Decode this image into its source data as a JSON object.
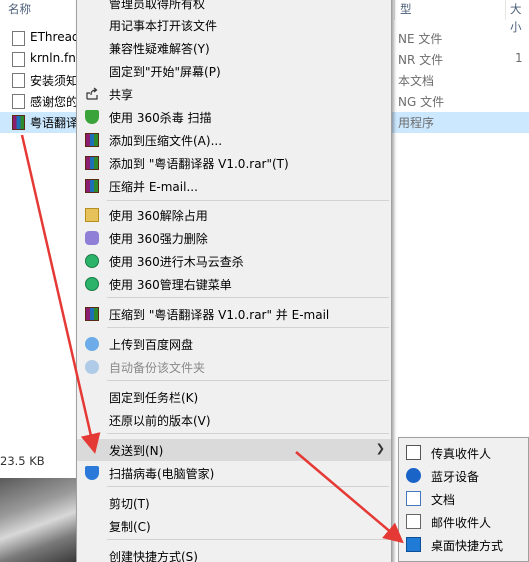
{
  "explorer": {
    "columns": {
      "name": "名称",
      "type": "型",
      "size": "大小"
    },
    "files": [
      {
        "name": "EThread",
        "type": "NE 文件",
        "size": ""
      },
      {
        "name": "krnln.fn",
        "type": "NR 文件",
        "size": "1"
      },
      {
        "name": "安装须知",
        "type": "本文档",
        "size": ""
      },
      {
        "name": "感谢您的",
        "type": "NG 文件",
        "size": ""
      },
      {
        "name": "粤语翻译",
        "type": "用程序",
        "size": ""
      }
    ],
    "status_size": "23.5 KB"
  },
  "context_menu": {
    "items": [
      {
        "label": "管理员取得所有权",
        "icon": "none"
      },
      {
        "label": "用记事本打开该文件",
        "icon": "none"
      },
      {
        "label": "兼容性疑难解答(Y)",
        "icon": "none"
      },
      {
        "label": "固定到\"开始\"屏幕(P)",
        "icon": "none"
      },
      {
        "label": "共享",
        "icon": "share-icon"
      },
      {
        "label": "使用 360杀毒 扫描",
        "icon": "360-antivirus-icon"
      },
      {
        "label": "添加到压缩文件(A)...",
        "icon": "winrar-icon"
      },
      {
        "label": "添加到 \"粤语翻译器 V1.0.rar\"(T)",
        "icon": "winrar-icon"
      },
      {
        "label": "压缩并 E-mail...",
        "icon": "winrar-icon"
      },
      {
        "label": "使用 360解除占用",
        "icon": "360-unlock-icon"
      },
      {
        "label": "使用 360强力删除",
        "icon": "360-delete-icon"
      },
      {
        "label": "使用 360进行木马云查杀",
        "icon": "360-trojan-icon"
      },
      {
        "label": "使用 360管理右键菜单",
        "icon": "360-menu-icon"
      },
      {
        "label": "压缩到 \"粤语翻译器 V1.0.rar\" 并 E-mail",
        "icon": "winrar-icon"
      },
      {
        "label": "上传到百度网盘",
        "icon": "baidu-cloud-icon"
      },
      {
        "label": "自动备份该文件夹",
        "icon": "baidu-cloud-icon"
      },
      {
        "label": "固定到任务栏(K)",
        "icon": "none"
      },
      {
        "label": "还原以前的版本(V)",
        "icon": "none"
      },
      {
        "label": "发送到(N)",
        "icon": "none"
      },
      {
        "label": "扫描病毒(电脑管家)",
        "icon": "tencent-pc-manager-icon"
      },
      {
        "label": "剪切(T)",
        "icon": "none"
      },
      {
        "label": "复制(C)",
        "icon": "none"
      },
      {
        "label": "创建快捷方式(S)",
        "icon": "none"
      }
    ],
    "submenu_arrow": "❯"
  },
  "send_to_submenu": {
    "items": [
      {
        "label": "传真收件人",
        "icon": "fax-icon"
      },
      {
        "label": "蓝牙设备",
        "icon": "bluetooth-icon"
      },
      {
        "label": "文档",
        "icon": "documents-icon"
      },
      {
        "label": "邮件收件人",
        "icon": "mail-icon"
      },
      {
        "label": "桌面快捷方式",
        "icon": "desktop-shortcut-icon"
      }
    ]
  },
  "colors": {
    "menu_bg": "#f0f0f0",
    "highlight": "#dadada",
    "selected_row": "#cce8ff",
    "annotation_arrow": "#e53935"
  }
}
